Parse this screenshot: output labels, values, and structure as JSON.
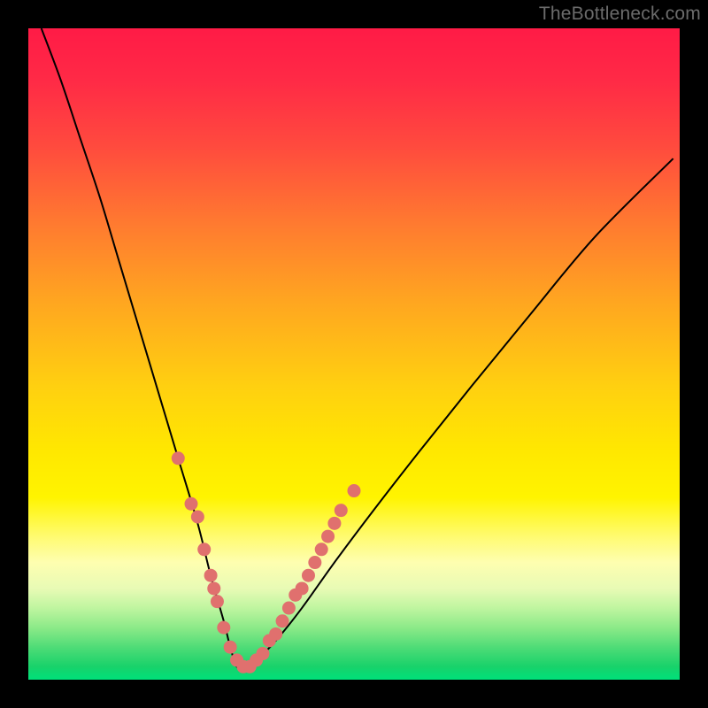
{
  "watermark": "TheBottleneck.com",
  "chart_data": {
    "type": "line",
    "title": "",
    "xlabel": "",
    "ylabel": "",
    "xlim": [
      0,
      100
    ],
    "ylim": [
      0,
      100
    ],
    "grid": false,
    "legend": false,
    "series": [
      {
        "name": "bottleneck-curve",
        "x": [
          2,
          5,
          8,
          11,
          14,
          17,
          20,
          23,
          26,
          28,
          30,
          31,
          32,
          33,
          35,
          38,
          42,
          47,
          53,
          60,
          68,
          77,
          87,
          99
        ],
        "y": [
          100,
          92,
          83,
          74,
          64,
          54,
          44,
          34,
          24,
          16,
          9,
          5,
          2,
          2,
          3,
          6,
          11,
          18,
          26,
          35,
          45,
          56,
          68,
          80
        ]
      }
    ],
    "markers": {
      "name": "highlight-dots",
      "color": "#e0706e",
      "points": [
        {
          "x": 23,
          "y": 34
        },
        {
          "x": 25,
          "y": 27
        },
        {
          "x": 26,
          "y": 25
        },
        {
          "x": 27,
          "y": 20
        },
        {
          "x": 28,
          "y": 16
        },
        {
          "x": 28.5,
          "y": 14
        },
        {
          "x": 29,
          "y": 12
        },
        {
          "x": 30,
          "y": 8
        },
        {
          "x": 31,
          "y": 5
        },
        {
          "x": 32,
          "y": 3
        },
        {
          "x": 33,
          "y": 2
        },
        {
          "x": 34,
          "y": 2
        },
        {
          "x": 35,
          "y": 3
        },
        {
          "x": 36,
          "y": 4
        },
        {
          "x": 37,
          "y": 6
        },
        {
          "x": 38,
          "y": 7
        },
        {
          "x": 39,
          "y": 9
        },
        {
          "x": 40,
          "y": 11
        },
        {
          "x": 41,
          "y": 13
        },
        {
          "x": 42,
          "y": 14
        },
        {
          "x": 43,
          "y": 16
        },
        {
          "x": 44,
          "y": 18
        },
        {
          "x": 45,
          "y": 20
        },
        {
          "x": 46,
          "y": 22
        },
        {
          "x": 47,
          "y": 24
        },
        {
          "x": 48,
          "y": 26
        },
        {
          "x": 50,
          "y": 29
        }
      ]
    },
    "background": {
      "type": "vertical-gradient",
      "stops": [
        {
          "pos": 0.0,
          "color": "#ff1b46"
        },
        {
          "pos": 0.35,
          "color": "#ff8a28"
        },
        {
          "pos": 0.65,
          "color": "#ffe800"
        },
        {
          "pos": 0.82,
          "color": "#fefeb0"
        },
        {
          "pos": 1.0,
          "color": "#00e07a"
        }
      ]
    }
  }
}
